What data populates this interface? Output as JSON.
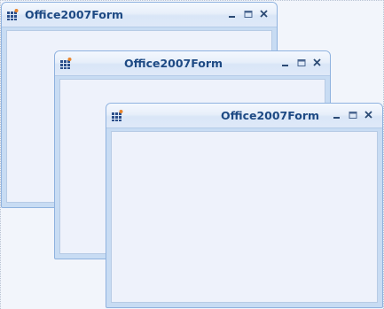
{
  "forms": [
    {
      "id": "form-1",
      "title": "Office2007Form",
      "buttons": {
        "minimize": "minimize-icon",
        "maximize": "maximize-icon",
        "close": "close-icon"
      }
    },
    {
      "id": "form-2",
      "title": "Office2007Form",
      "buttons": {
        "minimize": "minimize-icon",
        "maximize": "maximize-icon",
        "close": "close-icon"
      }
    },
    {
      "id": "form-3",
      "title": "Office2007Form",
      "buttons": {
        "minimize": "minimize-icon",
        "maximize": "maximize-icon",
        "close": "close-icon"
      }
    }
  ],
  "colors": {
    "title_text": "#1e4a84",
    "frame": "#c8dcf3",
    "client": "#eef2fb",
    "border": "#8fb2df"
  }
}
